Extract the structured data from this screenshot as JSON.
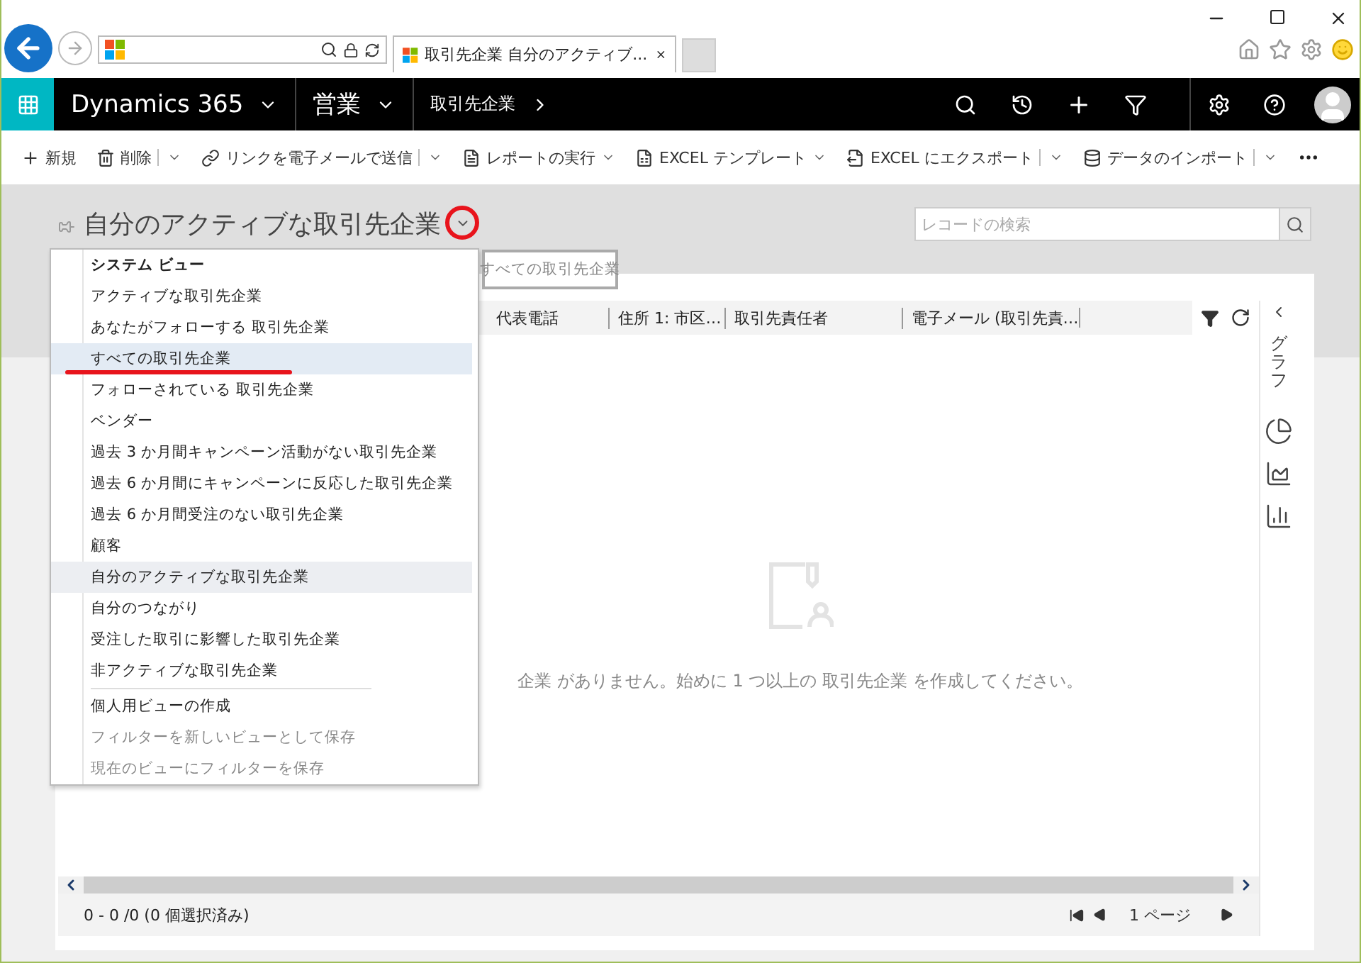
{
  "browser": {
    "tab_title": "取引先企業 自分のアクティブ..."
  },
  "nav": {
    "app": "Dynamics 365",
    "area": "営業",
    "entity": "取引先企業"
  },
  "commands": [
    "新規",
    "削除",
    "リンクを電子メールで送信",
    "レポートの実行",
    "EXCEL テンプレート",
    "EXCEL にエクスポート",
    "データのインポート"
  ],
  "view_title": "自分のアクティブな取引先企業",
  "search": {
    "placeholder": "レコードの検索"
  },
  "view_menu": {
    "heading": "システム ビュー",
    "views": [
      {
        "label": "アクティブな取引先企業",
        "highlighted": false,
        "current": false
      },
      {
        "label": "あなたがフォローする 取引先企業",
        "highlighted": false,
        "current": false
      },
      {
        "label": "すべての取引先企業",
        "highlighted": true,
        "current": false
      },
      {
        "label": "フォローされている 取引先企業",
        "highlighted": false,
        "current": false
      },
      {
        "label": "ベンダー",
        "highlighted": false,
        "current": false
      },
      {
        "label": "過去 3 か月間キャンペーン活動がない取引先企業",
        "highlighted": false,
        "current": false
      },
      {
        "label": "過去 6 か月間にキャンペーンに反応した取引先企業",
        "highlighted": false,
        "current": false
      },
      {
        "label": "過去 6 か月間受注のない取引先企業",
        "highlighted": false,
        "current": false
      },
      {
        "label": "顧客",
        "highlighted": false,
        "current": false
      },
      {
        "label": "自分のアクティブな取引先企業",
        "highlighted": false,
        "current": true
      },
      {
        "label": "自分のつながり",
        "highlighted": false,
        "current": false
      },
      {
        "label": "受注した取引に影響した取引先企業",
        "highlighted": false,
        "current": false
      },
      {
        "label": "非アクティブな取引先企業",
        "highlighted": false,
        "current": false
      }
    ],
    "actions": [
      {
        "label": "個人用ビューの作成",
        "disabled": false
      },
      {
        "label": "フィルターを新しいビューとして保存",
        "disabled": true
      },
      {
        "label": "現在のビューにフィルターを保存",
        "disabled": true
      }
    ]
  },
  "tooltip": "すべての取引先企業",
  "columns": [
    "代表電話",
    "住所 1: 市区…",
    "取引先責任者",
    "電子メール (取引先責…"
  ],
  "chart_pane": {
    "label": "グラフ"
  },
  "empty_message": "企業 がありません。始めに 1 つ以上の 取引先企業 を作成してください。",
  "footer": {
    "count": "0 - 0 /0 (0 個選択済み)",
    "page": "1 ページ"
  }
}
